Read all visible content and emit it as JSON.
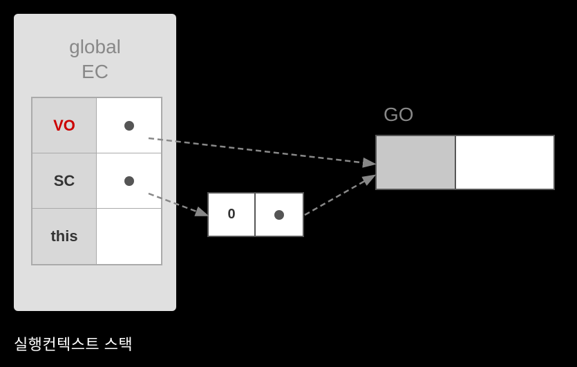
{
  "globalEC": {
    "label_line1": "global",
    "label_line2": "EC",
    "rows": [
      {
        "left": "VO",
        "leftColor": "#cc0000"
      },
      {
        "left": "SC",
        "leftColor": "#333"
      },
      {
        "left": "this",
        "leftColor": "#333"
      }
    ]
  },
  "scObject": {
    "value": "0"
  },
  "goObject": {
    "label": "GO"
  },
  "footer": {
    "label": "실행컨텍스트 스택"
  },
  "colors": {
    "background": "#000000",
    "globalECBg": "#e0e0e0",
    "tableBorder": "#aaa",
    "arrow": "#888",
    "dot": "#555"
  }
}
